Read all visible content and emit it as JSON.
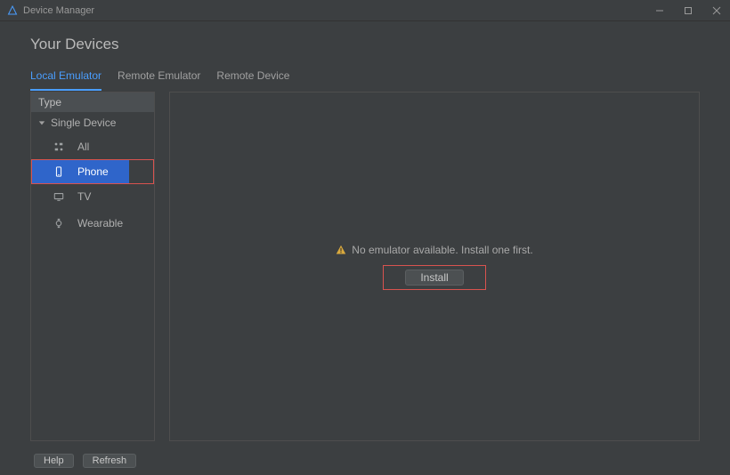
{
  "window": {
    "title": "Device Manager"
  },
  "heading": "Your Devices",
  "tabs": [
    {
      "label": "Local Emulator",
      "active": true
    },
    {
      "label": "Remote Emulator",
      "active": false
    },
    {
      "label": "Remote Device",
      "active": false
    }
  ],
  "sidebar": {
    "type_header": "Type",
    "group_label": "Single Device",
    "items": [
      {
        "label": "All",
        "icon": "grid-icon",
        "selected": false
      },
      {
        "label": "Phone",
        "icon": "phone-icon",
        "selected": true
      },
      {
        "label": "TV",
        "icon": "tv-icon",
        "selected": false
      },
      {
        "label": "Wearable",
        "icon": "watch-icon",
        "selected": false
      }
    ]
  },
  "pane": {
    "status_text": "No emulator available. Install one first.",
    "install_label": "Install"
  },
  "footer": {
    "help": "Help",
    "refresh": "Refresh"
  }
}
